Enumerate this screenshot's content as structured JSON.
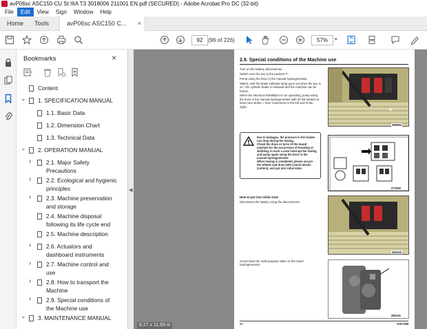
{
  "window": {
    "title": "avP06sc ASC150 CU St IIIA T3 3018006 211001 EN.pdf (SECURED) - Adobe Acrobat Pro DC (32-bit)"
  },
  "menu": {
    "items": [
      "File",
      "Edit",
      "View",
      "Sign",
      "Window",
      "Help"
    ],
    "active": "Edit"
  },
  "tabs": {
    "home": "Home",
    "tools": "Tools",
    "doc": "avP06sc ASC150 C...",
    "close": "×"
  },
  "toolbar": {
    "page_current": "92",
    "page_count": "(96 of 226)",
    "zoom": "57%"
  },
  "bookmarks": {
    "title": "Bookmarks",
    "close": "×",
    "items": [
      {
        "label": "Content",
        "level": 0,
        "expander": ""
      },
      {
        "label": "1. SPECIFICATION MANUAL",
        "level": 0,
        "expander": "open"
      },
      {
        "label": "1.1. Basic Data",
        "level": 1,
        "expander": ""
      },
      {
        "label": "1.2. Dimension Chart",
        "level": 1,
        "expander": ""
      },
      {
        "label": "1.3. Technical Data",
        "level": 1,
        "expander": ""
      },
      {
        "label": "2. OPERATION MANUAL",
        "level": 0,
        "expander": "open"
      },
      {
        "label": "2.1. Major Safety",
        "label2": "Precautions",
        "level": 1,
        "expander": "closed"
      },
      {
        "label": "2.2. Ecological and hygienic",
        "label2": "principles",
        "level": 1,
        "expander": "closed"
      },
      {
        "label": "2.3. Machine preservation",
        "label2": "and storage",
        "level": 1,
        "expander": "closed"
      },
      {
        "label": "2.4. Machine disposal",
        "label2": "following its life cycle end",
        "level": 1,
        "expander": ""
      },
      {
        "label": "2.5. Machine description",
        "level": 1,
        "expander": ""
      },
      {
        "label": "2.6. Actuators and",
        "label2": "dashboard instruments",
        "level": 1,
        "expander": "closed"
      },
      {
        "label": "2.7. Machine control and",
        "label2": "use",
        "level": 1,
        "expander": "closed"
      },
      {
        "label": "2.8. How to transport the",
        "label2": "Machine",
        "level": 1,
        "expander": "closed"
      },
      {
        "label": "2.9. Special conditions of",
        "label2": "the Machine use",
        "level": 1,
        "expander": "closed"
      },
      {
        "label": "3. MAINTENANCE MANUAL",
        "level": 0,
        "expander": "open"
      }
    ]
  },
  "viewer": {
    "page_size": "8.27 x 11.69 in"
  },
  "page": {
    "section_title": "2.9.    Special conditions of the Machine use",
    "bullets": [
      "Turn on the battery disconnector.",
      "Switch over the key to the position \"I\".",
      "Pump using the lever in the manual hydrogenerator.",
      "Watch, until the brake indicator lamp goes out when the key is on. The cylinder brake is released and the machine can be towed.",
      "When the electrical installation is not operating, pump using the lever in the manual hydrogenerator with 30 full strokes at least (one stroke = lever movement to the left and to the right)."
    ],
    "warning": [
      "Due to leakages, the pressure in the brakes can drop during the towing.",
      "Check the drum or tyres of the towed machine for the occurrence of breaking or skidding. In such a case interrupt the towing and pump again using the lever in the manual hydrogenerator.",
      "When towing is completed, please secure the wheels and drum with scotch blocks (cotters), and put into initial state."
    ],
    "fig1_cap": "396084",
    "fig2_cap": "277920",
    "fig3_cap": "264103",
    "fig4_cap": "282115",
    "subhead": "How to put into initial state",
    "subtext": "Disconnect the battery using the disconnector.",
    "subtext2": "Screw back the multi-purpose valve on the travel hydrogenerator.",
    "footer_left": "92",
    "footer_right": "ASC150"
  }
}
